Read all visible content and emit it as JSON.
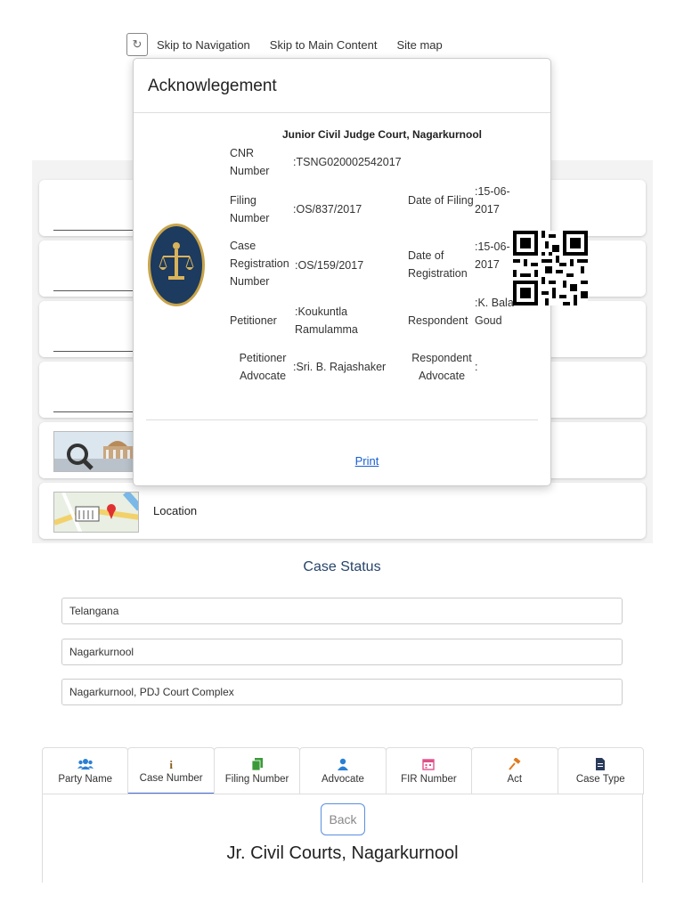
{
  "topbar": {
    "skip_nav": "Skip to Navigation",
    "skip_main": "Skip to Main Content",
    "site_map": "Site map"
  },
  "menu": {
    "location_label": "Location"
  },
  "modal": {
    "title": "Acknowlegement",
    "court_name": "Junior Civil Judge Court, Nagarkurnool",
    "cnr_label": "CNR Number",
    "cnr_value": ":TSNG020002542017",
    "filing_no_label": "Filing Number",
    "filing_no_value": ":OS/837/2017",
    "filing_date_label": "Date of Filing",
    "filing_date_value": ":15-06-2017",
    "reg_no_label": "Case Registration Number",
    "reg_no_value": ":OS/159/2017",
    "reg_date_label": "Date of Registration",
    "reg_date_value": ":15-06-2017",
    "petitioner_label": "Petitioner",
    "petitioner_value": ":Koukuntla Ramulamma",
    "respondent_label": "Respondent",
    "respondent_value": ":K. Bala Goud",
    "pet_adv_label": "Petitioner Advocate",
    "pet_adv_value": ":Sri. B. Rajashaker",
    "resp_adv_label": "Respondent Advocate",
    "resp_adv_value": ":",
    "print_label": "Print"
  },
  "case_status": {
    "title": "Case Status",
    "state": "Telangana",
    "district": "Nagarkurnool",
    "complex": "Nagarkurnool, PDJ Court Complex"
  },
  "tabs": [
    {
      "label": "Party Name",
      "icon": "users-icon"
    },
    {
      "label": "Case Number",
      "icon": "info-icon"
    },
    {
      "label": "Filing Number",
      "icon": "files-icon"
    },
    {
      "label": "Advocate",
      "icon": "user-icon"
    },
    {
      "label": "FIR Number",
      "icon": "calendar-icon"
    },
    {
      "label": "Act",
      "icon": "gavel-icon"
    },
    {
      "label": "Case Type",
      "icon": "file-icon"
    }
  ],
  "content": {
    "back_label": "Back",
    "court_title": "Jr. Civil Courts, Nagarkurnool"
  },
  "colors": {
    "accent": "#4a6fd4",
    "title_blue": "#27446b",
    "link": "#1a5fd0",
    "tab_icon_blue": "#2a7fd4",
    "tab_icon_brown": "#8a5a1a",
    "tab_icon_green": "#3a9a3a",
    "tab_icon_pink": "#e0508a",
    "tab_icon_orange": "#e07a1a",
    "tab_icon_navy": "#2a3a5a"
  }
}
